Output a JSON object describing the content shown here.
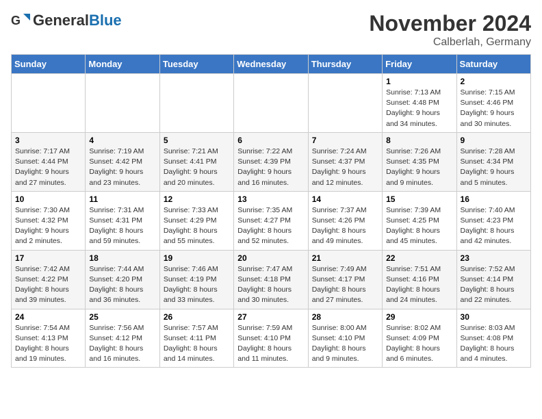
{
  "header": {
    "logo_general": "General",
    "logo_blue": "Blue",
    "month_title": "November 2024",
    "location": "Calberlah, Germany"
  },
  "weekdays": [
    "Sunday",
    "Monday",
    "Tuesday",
    "Wednesday",
    "Thursday",
    "Friday",
    "Saturday"
  ],
  "weeks": [
    [
      {
        "day": "",
        "sunrise": "",
        "sunset": "",
        "daylight": ""
      },
      {
        "day": "",
        "sunrise": "",
        "sunset": "",
        "daylight": ""
      },
      {
        "day": "",
        "sunrise": "",
        "sunset": "",
        "daylight": ""
      },
      {
        "day": "",
        "sunrise": "",
        "sunset": "",
        "daylight": ""
      },
      {
        "day": "",
        "sunrise": "",
        "sunset": "",
        "daylight": ""
      },
      {
        "day": "1",
        "sunrise": "Sunrise: 7:13 AM",
        "sunset": "Sunset: 4:48 PM",
        "daylight": "Daylight: 9 hours and 34 minutes."
      },
      {
        "day": "2",
        "sunrise": "Sunrise: 7:15 AM",
        "sunset": "Sunset: 4:46 PM",
        "daylight": "Daylight: 9 hours and 30 minutes."
      }
    ],
    [
      {
        "day": "3",
        "sunrise": "Sunrise: 7:17 AM",
        "sunset": "Sunset: 4:44 PM",
        "daylight": "Daylight: 9 hours and 27 minutes."
      },
      {
        "day": "4",
        "sunrise": "Sunrise: 7:19 AM",
        "sunset": "Sunset: 4:42 PM",
        "daylight": "Daylight: 9 hours and 23 minutes."
      },
      {
        "day": "5",
        "sunrise": "Sunrise: 7:21 AM",
        "sunset": "Sunset: 4:41 PM",
        "daylight": "Daylight: 9 hours and 20 minutes."
      },
      {
        "day": "6",
        "sunrise": "Sunrise: 7:22 AM",
        "sunset": "Sunset: 4:39 PM",
        "daylight": "Daylight: 9 hours and 16 minutes."
      },
      {
        "day": "7",
        "sunrise": "Sunrise: 7:24 AM",
        "sunset": "Sunset: 4:37 PM",
        "daylight": "Daylight: 9 hours and 12 minutes."
      },
      {
        "day": "8",
        "sunrise": "Sunrise: 7:26 AM",
        "sunset": "Sunset: 4:35 PM",
        "daylight": "Daylight: 9 hours and 9 minutes."
      },
      {
        "day": "9",
        "sunrise": "Sunrise: 7:28 AM",
        "sunset": "Sunset: 4:34 PM",
        "daylight": "Daylight: 9 hours and 5 minutes."
      }
    ],
    [
      {
        "day": "10",
        "sunrise": "Sunrise: 7:30 AM",
        "sunset": "Sunset: 4:32 PM",
        "daylight": "Daylight: 9 hours and 2 minutes."
      },
      {
        "day": "11",
        "sunrise": "Sunrise: 7:31 AM",
        "sunset": "Sunset: 4:31 PM",
        "daylight": "Daylight: 8 hours and 59 minutes."
      },
      {
        "day": "12",
        "sunrise": "Sunrise: 7:33 AM",
        "sunset": "Sunset: 4:29 PM",
        "daylight": "Daylight: 8 hours and 55 minutes."
      },
      {
        "day": "13",
        "sunrise": "Sunrise: 7:35 AM",
        "sunset": "Sunset: 4:27 PM",
        "daylight": "Daylight: 8 hours and 52 minutes."
      },
      {
        "day": "14",
        "sunrise": "Sunrise: 7:37 AM",
        "sunset": "Sunset: 4:26 PM",
        "daylight": "Daylight: 8 hours and 49 minutes."
      },
      {
        "day": "15",
        "sunrise": "Sunrise: 7:39 AM",
        "sunset": "Sunset: 4:25 PM",
        "daylight": "Daylight: 8 hours and 45 minutes."
      },
      {
        "day": "16",
        "sunrise": "Sunrise: 7:40 AM",
        "sunset": "Sunset: 4:23 PM",
        "daylight": "Daylight: 8 hours and 42 minutes."
      }
    ],
    [
      {
        "day": "17",
        "sunrise": "Sunrise: 7:42 AM",
        "sunset": "Sunset: 4:22 PM",
        "daylight": "Daylight: 8 hours and 39 minutes."
      },
      {
        "day": "18",
        "sunrise": "Sunrise: 7:44 AM",
        "sunset": "Sunset: 4:20 PM",
        "daylight": "Daylight: 8 hours and 36 minutes."
      },
      {
        "day": "19",
        "sunrise": "Sunrise: 7:46 AM",
        "sunset": "Sunset: 4:19 PM",
        "daylight": "Daylight: 8 hours and 33 minutes."
      },
      {
        "day": "20",
        "sunrise": "Sunrise: 7:47 AM",
        "sunset": "Sunset: 4:18 PM",
        "daylight": "Daylight: 8 hours and 30 minutes."
      },
      {
        "day": "21",
        "sunrise": "Sunrise: 7:49 AM",
        "sunset": "Sunset: 4:17 PM",
        "daylight": "Daylight: 8 hours and 27 minutes."
      },
      {
        "day": "22",
        "sunrise": "Sunrise: 7:51 AM",
        "sunset": "Sunset: 4:16 PM",
        "daylight": "Daylight: 8 hours and 24 minutes."
      },
      {
        "day": "23",
        "sunrise": "Sunrise: 7:52 AM",
        "sunset": "Sunset: 4:14 PM",
        "daylight": "Daylight: 8 hours and 22 minutes."
      }
    ],
    [
      {
        "day": "24",
        "sunrise": "Sunrise: 7:54 AM",
        "sunset": "Sunset: 4:13 PM",
        "daylight": "Daylight: 8 hours and 19 minutes."
      },
      {
        "day": "25",
        "sunrise": "Sunrise: 7:56 AM",
        "sunset": "Sunset: 4:12 PM",
        "daylight": "Daylight: 8 hours and 16 minutes."
      },
      {
        "day": "26",
        "sunrise": "Sunrise: 7:57 AM",
        "sunset": "Sunset: 4:11 PM",
        "daylight": "Daylight: 8 hours and 14 minutes."
      },
      {
        "day": "27",
        "sunrise": "Sunrise: 7:59 AM",
        "sunset": "Sunset: 4:10 PM",
        "daylight": "Daylight: 8 hours and 11 minutes."
      },
      {
        "day": "28",
        "sunrise": "Sunrise: 8:00 AM",
        "sunset": "Sunset: 4:10 PM",
        "daylight": "Daylight: 8 hours and 9 minutes."
      },
      {
        "day": "29",
        "sunrise": "Sunrise: 8:02 AM",
        "sunset": "Sunset: 4:09 PM",
        "daylight": "Daylight: 8 hours and 6 minutes."
      },
      {
        "day": "30",
        "sunrise": "Sunrise: 8:03 AM",
        "sunset": "Sunset: 4:08 PM",
        "daylight": "Daylight: 8 hours and 4 minutes."
      }
    ]
  ]
}
